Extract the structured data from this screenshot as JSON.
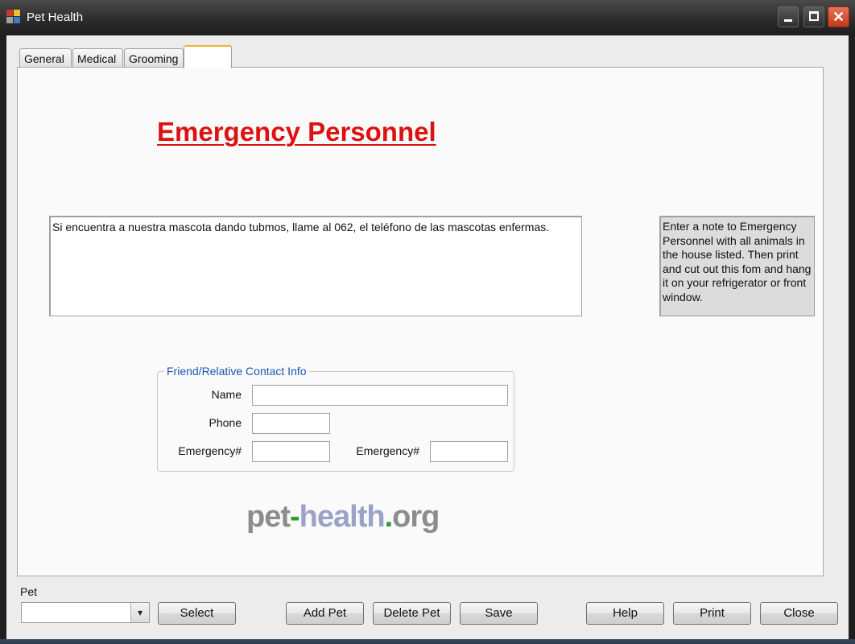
{
  "window": {
    "title": "Pet Health",
    "controls": {
      "minimize": "minimize-icon",
      "maximize": "maximize-icon",
      "close": "close-icon",
      "close_glyph": "✕"
    }
  },
  "tabs": [
    {
      "label": "General",
      "active": false
    },
    {
      "label": "Medical",
      "active": false
    },
    {
      "label": "Grooming",
      "active": false
    },
    {
      "label": "",
      "active": true
    }
  ],
  "main": {
    "heading": "Emergency Personnel",
    "note_text": "Si encuentra a nuestra mascota dando tubmos, llame al 062, el teléfono de las mascotas enfermas.",
    "hint_text": "Enter a note to Emergency Personnel with all animals in the house listed.  Then print and cut out this fom and hang it on your refrigerator or front window.",
    "contact_group": {
      "legend": "Friend/Relative Contact Info",
      "name_label": "Name",
      "name_value": "",
      "phone_label": "Phone",
      "phone_value": "",
      "emergency1_label": "Emergency#",
      "emergency1_value": "",
      "emergency2_label": "Emergency#",
      "emergency2_value": ""
    },
    "logo": {
      "part1": "pet",
      "dash": "-",
      "part2": "health",
      "dot": ".",
      "part3": "org"
    }
  },
  "footer": {
    "pet_label": "Pet",
    "pet_selected": "",
    "dropdown_glyph": "▾",
    "buttons": {
      "select": "Select",
      "add_pet": "Add Pet",
      "delete_pet": "Delete Pet",
      "save": "Save",
      "help": "Help",
      "print": "Print",
      "close": "Close"
    }
  },
  "colors": {
    "heading": "#dd1111",
    "legend": "#1a56b0",
    "logo_gray": "#8c8c8c",
    "logo_green": "#2aa02a",
    "logo_blue": "#9aa2c8"
  }
}
